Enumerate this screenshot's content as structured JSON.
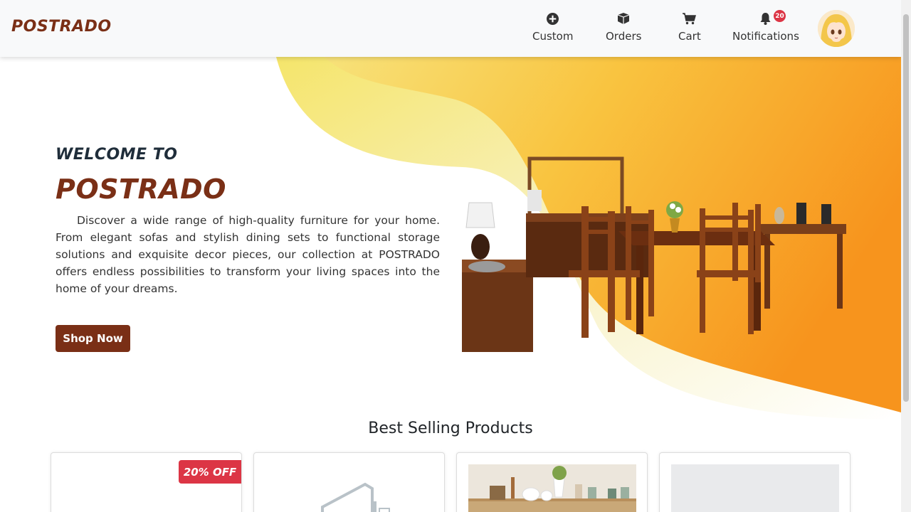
{
  "brand": "POSTRADO",
  "nav": {
    "custom": "Custom",
    "orders": "Orders",
    "cart": "Cart",
    "notifications": "Notifications",
    "notification_count": "20"
  },
  "icons": {
    "custom": "plus-circle-icon",
    "orders": "box-icon",
    "cart": "cart-icon",
    "notifications": "bell-icon"
  },
  "hero": {
    "welcome": "WELCOME TO",
    "title": "POSTRADO",
    "description": "Discover a wide range of high-quality furniture for your home. From elegant sofas and stylish dining sets to functional storage solutions and exquisite decor pieces, our collection at POSTRADO offers endless possibilities to transform your living spaces into the home of your dreams.",
    "cta": "Shop Now"
  },
  "best_selling": {
    "title": "Best Selling Products",
    "cards": [
      {
        "badge": "20% OFF"
      },
      {
        "badge": ""
      },
      {
        "badge": ""
      },
      {
        "badge": ""
      }
    ]
  },
  "colors": {
    "brand": "#7a2f16",
    "navbar_bg": "#f8f9fa",
    "badge": "#dc3545",
    "hero_orange": "#f7941d",
    "hero_yellow": "#f7e27a"
  }
}
